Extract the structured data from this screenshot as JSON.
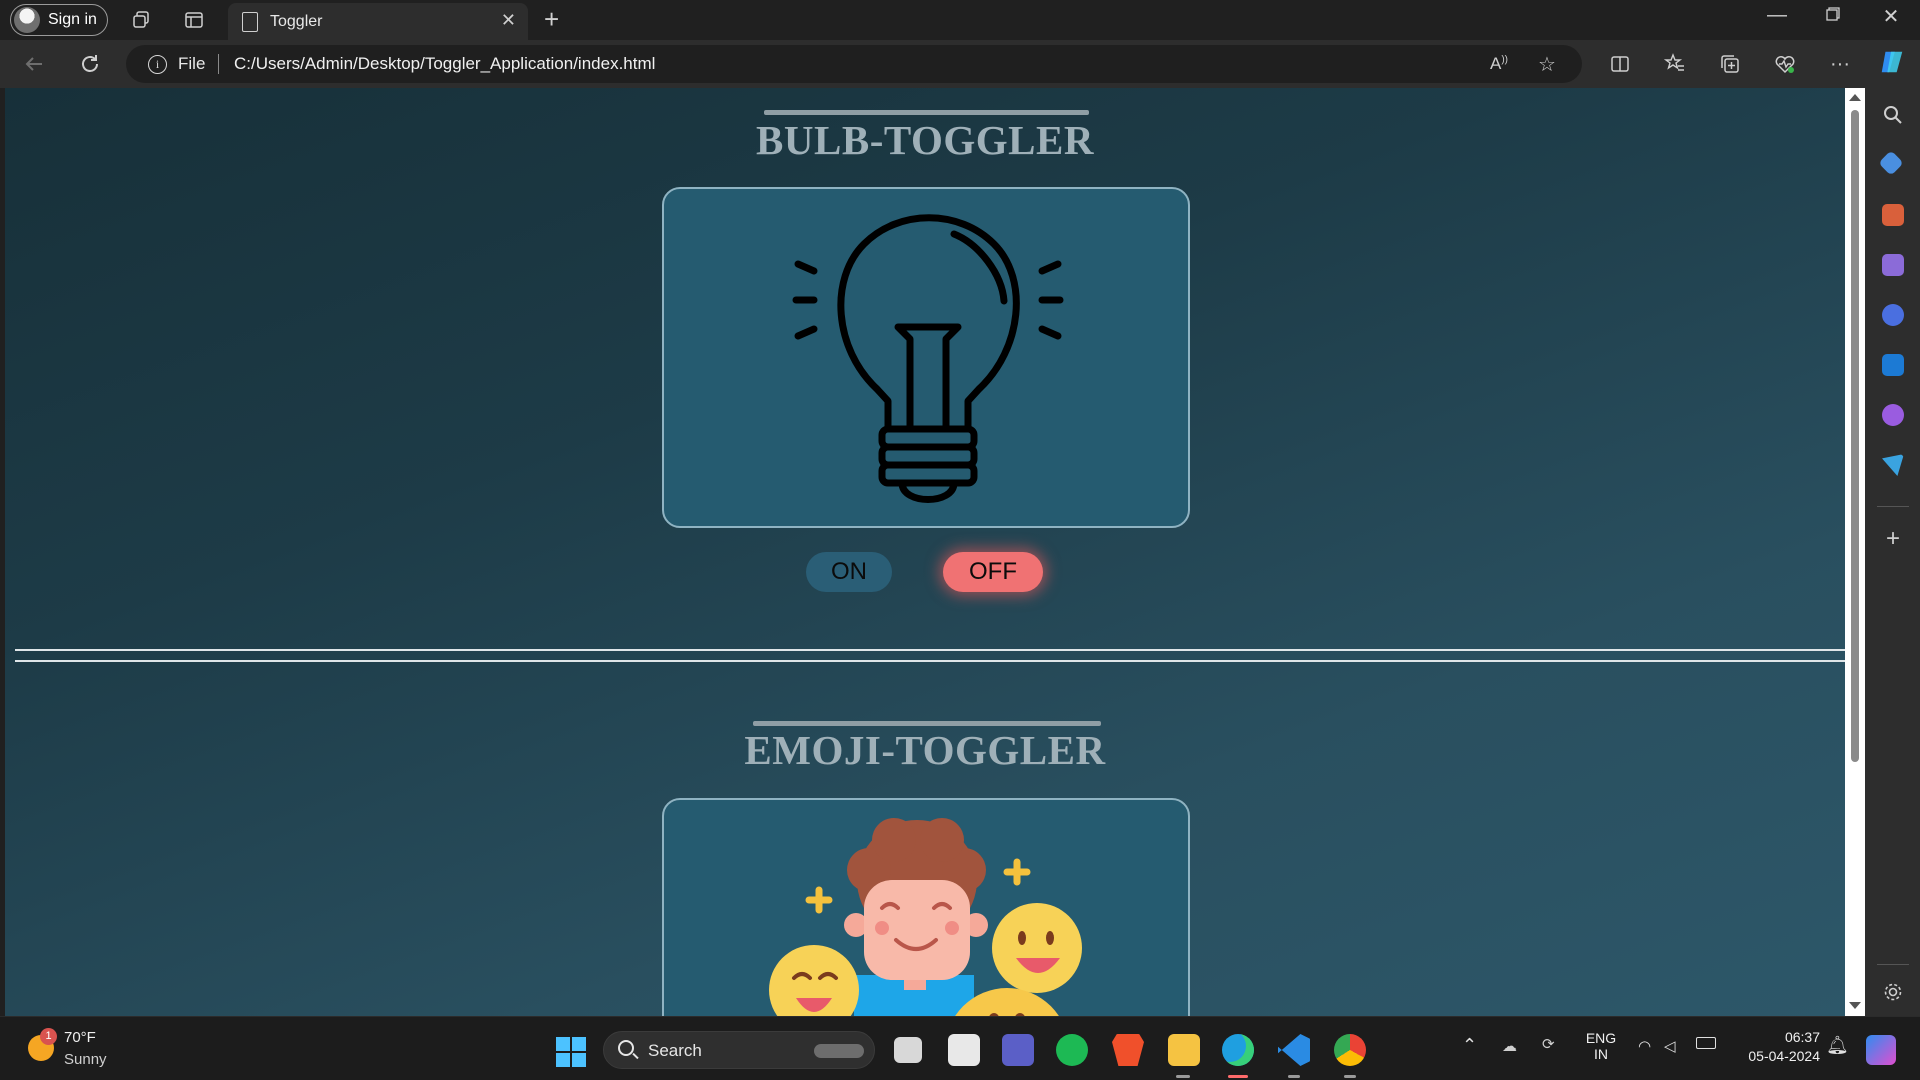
{
  "browser": {
    "profile_label": "Sign in",
    "tab_title": "Toggler",
    "new_tab_symbol": "+",
    "address_scheme_label": "File",
    "url": "C:/Users/Admin/Desktop/Toggler_Application/index.html"
  },
  "page": {
    "bulb_section": {
      "title": "BULB-TOGGLER",
      "on_label": "ON",
      "off_label": "OFF",
      "bulb_state": "off"
    },
    "emoji_section": {
      "title": "EMOJI-TOGGLER"
    }
  },
  "taskbar": {
    "weather_badge": "1",
    "weather_temp": "70°F",
    "weather_condition": "Sunny",
    "search_label": "Search",
    "language_line1": "ENG",
    "language_line2": "IN",
    "time": "06:37",
    "date": "05-04-2024"
  },
  "colors": {
    "accent": "#4cc2ff",
    "off_button": "#f07273",
    "on_button": "#2a5e76",
    "card": "#255b70"
  }
}
